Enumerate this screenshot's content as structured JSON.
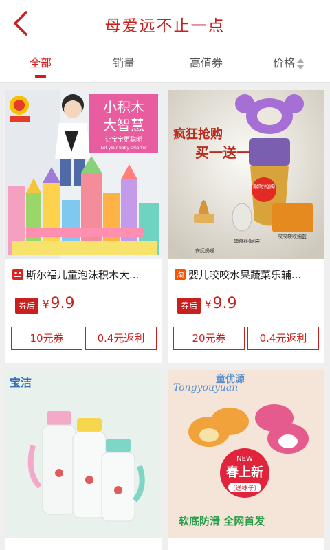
{
  "header": {
    "title": "母爱远不止一点",
    "back_icon": "chevron-left-icon"
  },
  "tabs": [
    {
      "label": "全部",
      "active": true
    },
    {
      "label": "销量"
    },
    {
      "label": "高值券"
    },
    {
      "label": "价格"
    }
  ],
  "colors": {
    "accent": "#c8201f",
    "background": "#efefef"
  },
  "products": [
    {
      "name": "斯尔福儿童泡沫积木大...",
      "platform": "tmall",
      "platform_label": "天猫",
      "badge": "券后",
      "currency": "¥",
      "price": "9.9",
      "coupon": "10元券",
      "rebate": "0.4元返利",
      "image_texts": [
        "小积木",
        "大智慧",
        "让宝宝更聪明",
        "Let your baby smarter"
      ]
    },
    {
      "name": "婴儿咬咬水果蔬菜乐辅...",
      "platform": "taobao",
      "platform_label": "淘",
      "badge": "券后",
      "currency": "¥",
      "price": "9.9",
      "coupon": "20元券",
      "rebate": "0.4元返利",
      "image_texts": [
        "疯狂抢购",
        "买一送一",
        "限时抢购",
        "安抚奶嘴",
        "辅食器(网袋)",
        "咬咬袋收纳盒"
      ]
    },
    {
      "name": "",
      "image_texts": [
        "宝洁"
      ]
    },
    {
      "name": "",
      "image_texts": [
        "童优源",
        "Tongyouyuan",
        "NEW",
        "春上新",
        "(送袜子)",
        "软底防滑 全网首发"
      ]
    }
  ]
}
